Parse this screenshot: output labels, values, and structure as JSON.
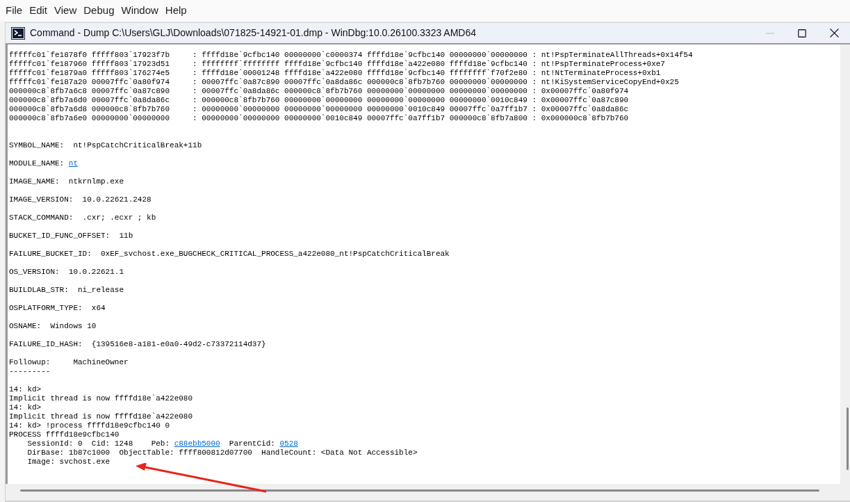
{
  "menu": [
    "File",
    "Edit",
    "View",
    "Debug",
    "Window",
    "Help"
  ],
  "window": {
    "title": "Command - Dump C:\\Users\\GLJ\\Downloads\\071825-14921-01.dmp - WinDbg:10.0.26100.3323 AMD64"
  },
  "output": {
    "blocks": [
      {
        "kind": "stack",
        "lines": [
          [
            {
              "text": "fffffc01`fe1878f0 fffff803`17923f7b     : ffffd18e`9cfbc140 00000000`c0000374 ffffd18e`9cfbc140 00000000`00000000 : nt!PspTerminateAllThreads+0x14f54"
            }
          ],
          [
            {
              "text": "fffffc01`fe187960 fffff803`17923d51     : ffffffff`ffffffff ffffd18e`9cfbc140 ffffd18e`a422e080 ffffd18e`9cfbc140 : nt!PspTerminateProcess+0xe7"
            }
          ],
          [
            {
              "text": "fffffc01`fe1879a0 fffff803`176274e5     : ffffd18e`00001248 ffffd18e`a422e080 ffffd18e`9cfbc140 ffffffff`f70f2e80 : nt!NtTerminateProcess+0xb1"
            }
          ],
          [
            {
              "text": "fffffc01`fe187a20 00007ffc`0a80f974     : 00007ffc`0a87c890 00007ffc`0a8da86c 000000c8`8fb7b760 00000000`00000000 : nt!KiSystemServiceCopyEnd+0x25"
            }
          ],
          [
            {
              "text": "000000c8`8fb7a6c8 00007ffc`0a87c890     : 00007ffc`0a8da86c 000000c8`8fb7b760 00000000`00000000 00000000`00000000 : 0x00007ffc`0a80f974"
            }
          ],
          [
            {
              "text": "000000c8`8fb7a6d0 00007ffc`0a8da86c     : 000000c8`8fb7b760 00000000`00000000 00000000`00000000 00000000`0010c849 : 0x00007ffc`0a87c890"
            }
          ],
          [
            {
              "text": "000000c8`8fb7a6d8 000000c8`8fb7b760     : 00000000`00000000 00000000`00000000 00000000`0010c849 00007ffc`0a7ff1b7 : 0x00007ffc`0a8da86c"
            }
          ],
          [
            {
              "text": "000000c8`8fb7a6e0 00000000`00000000     : 00000000`00000000 00000000`0010c849 00007ffc`0a7ff1b7 000000c8`8fb7a800 : 0x000000c8`8fb7b760"
            }
          ]
        ]
      },
      {
        "kind": "text",
        "lines": [
          [
            {
              "text": "SYMBOL_NAME:  nt!PspCatchCriticalBreak+11b"
            }
          ]
        ]
      },
      {
        "kind": "text",
        "lines": [
          [
            {
              "text": "MODULE_NAME: "
            },
            {
              "text": "nt",
              "link": true
            }
          ]
        ]
      },
      {
        "kind": "text",
        "lines": [
          [
            {
              "text": "IMAGE_NAME:  ntkrnlmp.exe"
            }
          ]
        ]
      },
      {
        "kind": "text",
        "lines": [
          [
            {
              "text": "IMAGE_VERSION:  10.0.22621.2428"
            }
          ]
        ]
      },
      {
        "kind": "text",
        "lines": [
          [
            {
              "text": "STACK_COMMAND:  .cxr; .ecxr ; kb"
            }
          ]
        ]
      },
      {
        "kind": "text",
        "lines": [
          [
            {
              "text": "BUCKET_ID_FUNC_OFFSET:  11b"
            }
          ]
        ]
      },
      {
        "kind": "text",
        "lines": [
          [
            {
              "text": "FAILURE_BUCKET_ID:  0xEF_svchost.exe_BUGCHECK_CRITICAL_PROCESS_a422e080_nt!PspCatchCriticalBreak"
            }
          ]
        ]
      },
      {
        "kind": "text",
        "lines": [
          [
            {
              "text": "OS_VERSION:  10.0.22621.1"
            }
          ]
        ]
      },
      {
        "kind": "text",
        "lines": [
          [
            {
              "text": "BUILDLAB_STR:  ni_release"
            }
          ]
        ]
      },
      {
        "kind": "text",
        "lines": [
          [
            {
              "text": "OSPLATFORM_TYPE:  x64"
            }
          ]
        ]
      },
      {
        "kind": "text",
        "lines": [
          [
            {
              "text": "OSNAME:  Windows 10"
            }
          ]
        ]
      },
      {
        "kind": "text",
        "lines": [
          [
            {
              "text": "FAILURE_ID_HASH:  {139516e8-a181-e0a0-49d2-c73372114d37}"
            }
          ]
        ]
      },
      {
        "kind": "text",
        "lines": [
          [
            {
              "text": "Followup:     MachineOwner"
            }
          ],
          [
            {
              "text": "---------"
            }
          ]
        ]
      },
      {
        "kind": "text",
        "lines": [
          [
            {
              "text": "14: kd>"
            }
          ],
          [
            {
              "text": "Implicit thread is now ffffd18e`a422e080"
            }
          ],
          [
            {
              "text": "14: kd>"
            }
          ],
          [
            {
              "text": "Implicit thread is now ffffd18e`a422e080"
            }
          ],
          [
            {
              "text": "14: kd> !process ffffd18e9cfbc140 0"
            }
          ],
          [
            {
              "text": "PROCESS ffffd18e9cfbc140"
            }
          ],
          [
            {
              "text": "    SessionId: 0  Cid: 1248    Peb: "
            },
            {
              "text": "c88ebb5000",
              "link": true
            },
            {
              "text": "  ParentCid: "
            },
            {
              "text": "0528",
              "link": true
            }
          ],
          [
            {
              "text": "    DirBase: 1b87c1000  ObjectTable: ffff800812d07700  HandleCount: <Data Not Accessible>"
            }
          ],
          [
            {
              "text": "    Image: svchost.exe"
            }
          ]
        ]
      }
    ]
  }
}
